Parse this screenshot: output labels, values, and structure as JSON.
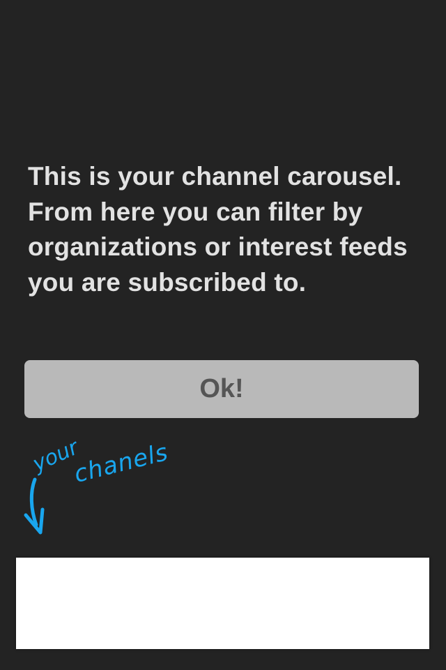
{
  "overlay": {
    "message": "This is your channel carousel. From here you can filter by organizations or interest feeds you are subscribed to.",
    "ok_label": "Ok!"
  },
  "hint": {
    "word1": "your",
    "word2": "chanels",
    "color": "#19a6ee",
    "icon": "arrow-down-left-icon"
  },
  "colors": {
    "background": "#232323",
    "text": "#e2e2e2",
    "button_bg": "#b9b9b9",
    "button_text": "#555555",
    "carousel_bg": "#ffffff"
  }
}
